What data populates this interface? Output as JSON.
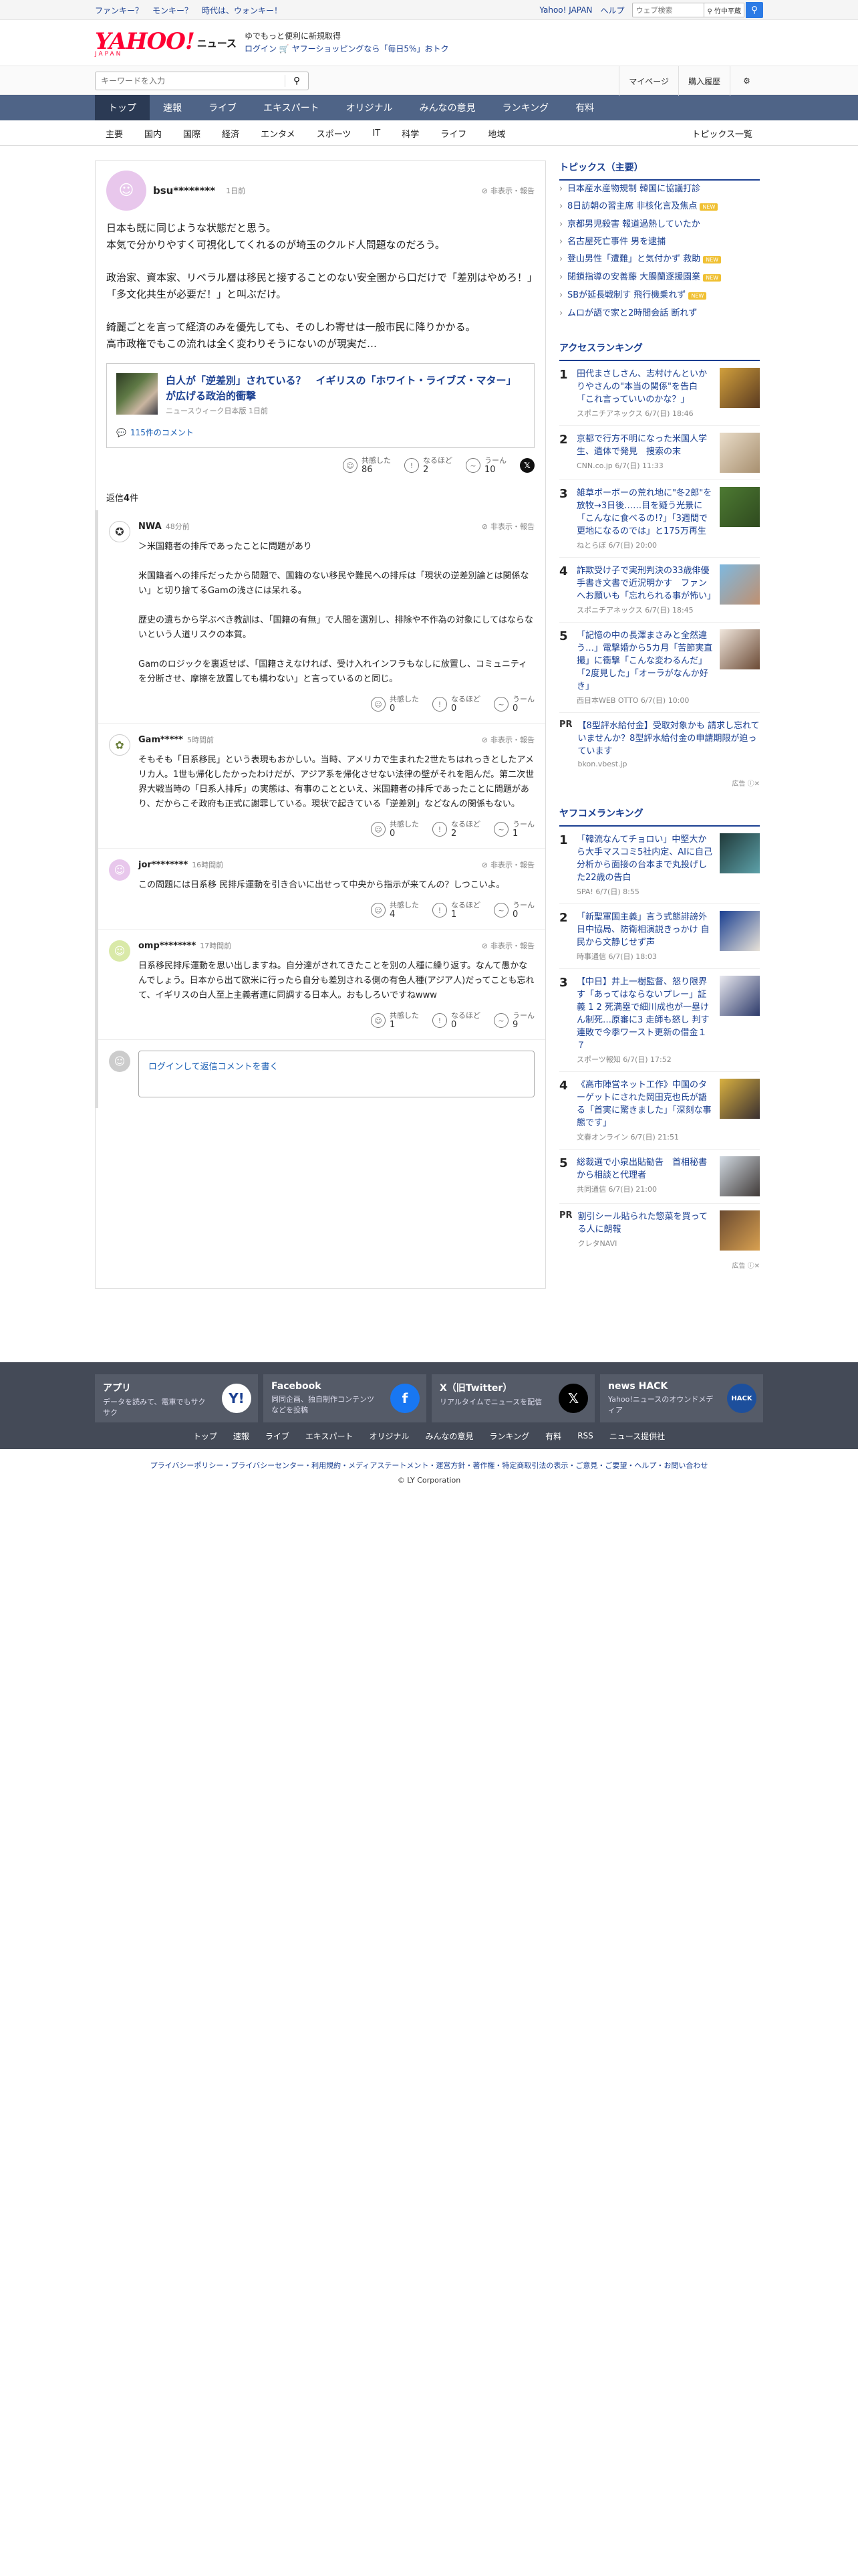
{
  "topline": {
    "promo": [
      "ファンキー？",
      "モンキー？",
      "時代は、ウォンキー！"
    ],
    "yahoo_link": "Yahoo! JAPAN",
    "help_link": "ヘルプ",
    "web_search_placeholder": "ウェブ検索",
    "web_search_kw": "竹中平蔵"
  },
  "header": {
    "logo_main": "YAHOO!",
    "logo_news": "ニュース",
    "logo_sub": "JAPAN",
    "promo_line1": "ゆでもっと便利に新規取得",
    "promo_login": "ログイン",
    "promo_line2": "ヤフーショッピングなら「毎日5%」おトク"
  },
  "searchbar": {
    "placeholder": "キーワードを入力",
    "mypage": "マイページ",
    "purchase": "購入履歴"
  },
  "nav_main": [
    "トップ",
    "速報",
    "ライブ",
    "エキスパート",
    "オリジナル",
    "みんなの意見",
    "ランキング",
    "有料"
  ],
  "nav_sub": [
    "主要",
    "国内",
    "国際",
    "経済",
    "エンタメ",
    "スポーツ",
    "IT",
    "科学",
    "ライフ",
    "地域"
  ],
  "nav_sub_all": "トピックス一覧",
  "comment": {
    "user": "bsu********",
    "time": "1日前",
    "report": "非表示・報告",
    "paragraphs": [
      "日本も既に同じような状態だと思う。\n本気で分かりやすく可視化してくれるのが埼玉のクルド人問題なのだろう。",
      "政治家、資本家、リベラル層は移民と接することのない安全圏から口だけで「差別はやめろ！」「多文化共生が必要だ！」と叫ぶだけ。",
      "綺麗ごとを言って経済のみを優先しても、そのしわ寄せは一般市民に降りかかる。\n高市政権でもこの流れは全く変わりそうにないのが現実だ…"
    ],
    "article": {
      "title": "白人が「逆差別」されている？　イギリスの「ホワイト・ライブズ・マター」が広げる政治的衝撃",
      "source": "ニュースウィーク日本版 1日前",
      "comments": "115件のコメント"
    },
    "reactions": [
      {
        "label": "共感した",
        "count": "86"
      },
      {
        "label": "なるほど",
        "count": "2"
      },
      {
        "label": "うーん",
        "count": "10"
      }
    ]
  },
  "replies_header": {
    "label": "返信",
    "count": "4",
    "suffix": "件"
  },
  "replies": [
    {
      "user": "NWA",
      "time": "48分前",
      "report": "非表示・報告",
      "paragraphs": [
        "＞米国籍者の排斥であったことに問題があり\n\n米国籍者への排斥だったから問題で、国籍のない移民や難民への排斥は「現状の逆差別論とは関係ない」と切り捨てるGamの浅さには呆れる。",
        "歴史の遺ちから学ぶべき教訓は、「国籍の有無」で人間を選別し、排除や不作為の対象にしてはならないという人道リスクの本質。",
        "Gamのロジックを裏返せば、「国籍さえなければ、受け入れインフラもなしに放置し、コミュニティを分断させ、摩擦を放置しても構わない」と言っているのと同じ。"
      ],
      "reactions": [
        {
          "label": "共感した",
          "count": "0"
        },
        {
          "label": "なるほど",
          "count": "0"
        },
        {
          "label": "うーん",
          "count": "0"
        }
      ]
    },
    {
      "user": "Gam*****",
      "time": "5時間前",
      "report": "非表示・報告",
      "paragraphs": [
        "そもそも「日系移民」という表現もおかしい。当時、アメリカで生まれた2世たちはれっきとしたアメリカ人。1世も帰化したかったわけだが、アジア系を帰化させない法律の壁がそれを阻んだ。第二次世界大戦当時の「日系人排斥」の実態は、有事のことといえ、米国籍者の排斥であったことに問題があり、だからこそ政府も正式に謝罪している。現状で起きている「逆差別」などなんの関係もない。"
      ],
      "reactions": [
        {
          "label": "共感した",
          "count": "0"
        },
        {
          "label": "なるほど",
          "count": "2"
        },
        {
          "label": "うーん",
          "count": "1"
        }
      ]
    },
    {
      "user": "jor********",
      "time": "16時間前",
      "report": "非表示・報告",
      "paragraphs": [
        "この問題には日系移 民排斥運動を引き合いに出せって中央から指示が来てんの？しつこいよ。"
      ],
      "reactions": [
        {
          "label": "共感した",
          "count": "4"
        },
        {
          "label": "なるほど",
          "count": "1"
        },
        {
          "label": "うーん",
          "count": "0"
        }
      ]
    },
    {
      "user": "omp********",
      "time": "17時間前",
      "report": "非表示・報告",
      "paragraphs": [
        "日系移民排斥運動を思い出しますね。自分達がされてきたことを別の人種に繰り返す。なんて愚かなんでしょう。日本から出て欧米に行ったら自分も差別される側の有色人種(アジア人)だってことも忘れて、イギリスの白人至上主義者連に同調する日本人。おもしろいですねwww"
      ],
      "reactions": [
        {
          "label": "共感した",
          "count": "1"
        },
        {
          "label": "なるほど",
          "count": "0"
        },
        {
          "label": "うーん",
          "count": "9"
        }
      ]
    }
  ],
  "reply_form": {
    "login": "ログイン",
    "rest": "して返信コメントを書く"
  },
  "sidebar": {
    "topics_title": "トピックス（主要）",
    "topics": [
      {
        "text": "日本産水産物規制 韓国に協議打診",
        "new": false
      },
      {
        "text": "8日訪朝の習主席 非核化言及焦点",
        "new": true
      },
      {
        "text": "京都男児殺害 報道過熱していたか",
        "new": false
      },
      {
        "text": "名古屋死亡事件 男を逮捕",
        "new": false
      },
      {
        "text": "登山男性「遭難」と気付かず 救助",
        "new": true
      },
      {
        "text": "閉鎖指導の安善藤 大腸蘭逐援園業",
        "new": true
      },
      {
        "text": "SBが延長戦制す 飛行機乗れず",
        "new": true
      },
      {
        "text": "ムロが語で家と2時間会話 断れず",
        "new": false
      }
    ],
    "new_badge": "NEW",
    "access_title": "アクセスランキング",
    "access": [
      {
        "rank": "1",
        "title": "田代まさしさん、志村けんといかりやさんの\"本当の関係\"を告白「これ言っていいのかな？」",
        "src": "スポニチアネックス 6/7(日) 18:46"
      },
      {
        "rank": "2",
        "title": "京都で行方不明になった米国人学生、遺体で発見　捜索の末",
        "src": "CNN.co.jp 6/7(日) 11:33"
      },
      {
        "rank": "3",
        "title": "雑草ボーボーの荒れ地に\"冬2郎\"を放牧→3日後……目を疑う光景に「こんなに食べるの!?」「3週間で更地になるのでは」と175万再生",
        "src": "ねとらぼ 6/7(日) 20:00"
      },
      {
        "rank": "4",
        "title": "詐欺受け子で実刑判決の33歳俳優　手書き文書で近況明かす　ファンへお願いも「忘れられる事が怖い」",
        "src": "スポニチアネックス 6/7(日) 18:45"
      },
      {
        "rank": "5",
        "title": "「記憶の中の長澤まさみと全然違う…」電撃婚から5カ月「苦節実直撮」に衝撃「こんな変わるんだ」「2度見した」「オーラがなんか好き」",
        "src": "西日本WEB OTTO 6/7(日) 10:00"
      }
    ],
    "pr1": {
      "label": "PR",
      "title": "【8型評水給付金】受取対象かも 請求し忘れていませんか？8型評水給付金の申請期限が迫っています",
      "src": "bkon.vbest.jp"
    },
    "ad_label": "広告",
    "yafoo_title": "ヤフコメランキング",
    "yafoo": [
      {
        "rank": "1",
        "title": "「韓流なんてチョロい」中堅大から大手マスコミ5社内定、AIに自己分析から面接の台本まで丸投げした22歳の告白",
        "src": "SPA! 6/7(日) 8:55"
      },
      {
        "rank": "2",
        "title": "「新聖軍国主義」言う式態誹謗外日中協局、防衛相演説きっかけ 自民から文静じせず声",
        "src": "時事通信 6/7(日) 18:03"
      },
      {
        "rank": "3",
        "title": "【中日】井上一樹監督、怒り限界す「あってはならないプレー」証義 1 2 死満塁で細川成也が一塁けん制死…原審に3 走師も怒し 判す　連敗で今季ワースト更新の借金１７",
        "src": "スポーツ報知 6/7(日) 17:52"
      },
      {
        "rank": "4",
        "title": "《高市陣営ネット工作》中国のターゲットにされた岡田克也氏が語る「首実に驚きました」「深刻な事態です」",
        "src": "文春オンライン 6/7(日) 21:51"
      },
      {
        "rank": "5",
        "title": "総裁選で小泉出貼勧告　首相秘書から相談と代理者",
        "src": "共同通信 6/7(日) 21:00"
      }
    ],
    "pr2": {
      "label": "PR",
      "title": "割引シール貼られた惣菜を買ってる人に朗報",
      "src": "クレタNAVI"
    }
  },
  "footer": {
    "apps": [
      {
        "title": "アプリ",
        "desc": "データを読みて、電車でもサクサク",
        "icon_color": "#ffffff"
      },
      {
        "title": "Facebook",
        "desc": "同同企画、独自制作コンテンツなどを投稿",
        "icon_color": "#1877f2"
      },
      {
        "title": "X（旧Twitter）",
        "desc": "リアルタイムでニュースを配信",
        "icon_color": "#000000"
      },
      {
        "title": "news HACK",
        "desc": "Yahoo!ニュースのオウンドメディア",
        "icon_color": "#1d4f9c"
      }
    ],
    "nav": [
      "トップ",
      "速報",
      "ライブ",
      "エキスパート",
      "オリジナル",
      "みんなの意見",
      "ランキング",
      "有料",
      "RSS",
      "ニュース提供社"
    ],
    "links": "プライバシーポリシー・プライバシーセンター・利用規約・メディアステートメント・運営方針・著作権・特定商取引法の表示・ご意見・ご要望・ヘルプ・お問い合わせ",
    "copyright": "© LY Corporation"
  },
  "colors": {
    "brand": "#ff0033",
    "nav": "#4f6487",
    "nav_active": "#2b3a54",
    "link": "#1a3f91"
  }
}
